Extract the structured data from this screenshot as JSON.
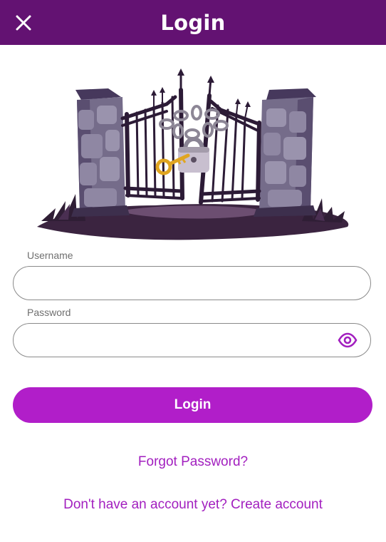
{
  "header": {
    "title": "Login",
    "close_icon": "close-icon",
    "background": "#631272"
  },
  "illustration": {
    "subject": "locked gate with padlock and key"
  },
  "form": {
    "username_label": "Username",
    "username_value": "",
    "password_label": "Password",
    "password_value": "",
    "password_toggle_icon": "eye-icon"
  },
  "actions": {
    "login_label": "Login",
    "login_color": "#b11ec9",
    "forgot_password": "Forgot Password?",
    "create_account": "Don't have an account yet? Create account",
    "link_color": "#a21fbf"
  }
}
